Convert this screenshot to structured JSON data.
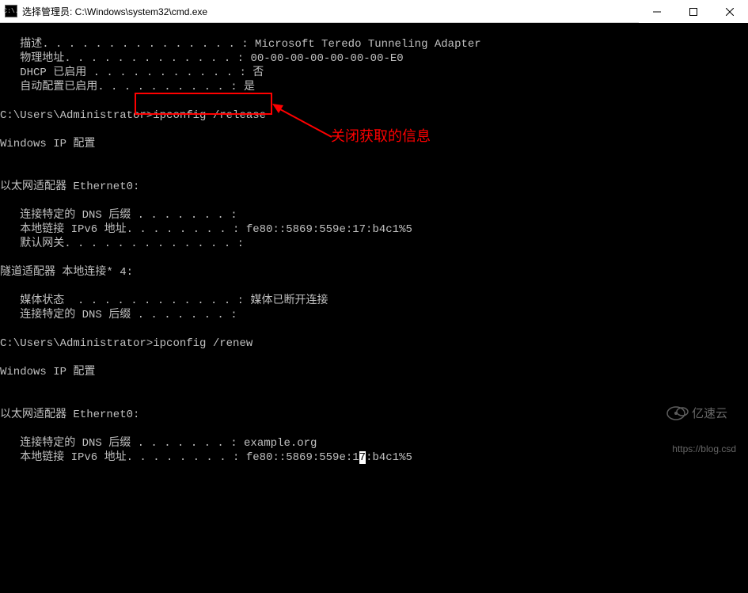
{
  "titlebar": {
    "icon_label": "C:\\.",
    "text": "选择管理员: C:\\Windows\\system32\\cmd.exe"
  },
  "terminal": {
    "lines": {
      "l1": "   描述. . . . . . . . . . . . . . . : Microsoft Teredo Tunneling Adapter",
      "l2": "   物理地址. . . . . . . . . . . . . : 00-00-00-00-00-00-00-E0",
      "l3": "   DHCP 已启用 . . . . . . . . . . . : 否",
      "l4": "   自动配置已启用. . . . . . . . . . : 是",
      "l5": "",
      "l6_pre": "C:\\Users\\Administrator>",
      "l6_cmd": "ipconfig /release",
      "l7": "",
      "l8": "Windows IP 配置",
      "l9": "",
      "l10": "",
      "l11": "以太网适配器 Ethernet0:",
      "l12": "",
      "l13": "   连接特定的 DNS 后缀 . . . . . . . :",
      "l14": "   本地链接 IPv6 地址. . . . . . . . : fe80::5869:559e:17:b4c1%5",
      "l15": "   默认网关. . . . . . . . . . . . . :",
      "l16": "",
      "l17": "隧道适配器 本地连接* 4:",
      "l18": "",
      "l19": "   媒体状态  . . . . . . . . . . . . : 媒体已断开连接",
      "l20": "   连接特定的 DNS 后缀 . . . . . . . :",
      "l21": "",
      "l22_pre": "C:\\Users\\Administrator>",
      "l22_cmd": "ipconfig /renew",
      "l23": "",
      "l24": "Windows IP 配置",
      "l25": "",
      "l26": "",
      "l27": "以太网适配器 Ethernet0:",
      "l28": "",
      "l29": "   连接特定的 DNS 后缀 . . . . . . . : example.org",
      "l30a": "   本地链接 IPv6 地址. . . . . . . . : fe80::5869:559e:1",
      "l30sel": "7",
      "l30b": ":b4c1%5"
    }
  },
  "annotation": {
    "text": "关闭获取的信息"
  },
  "watermark": {
    "brand": "亿速云",
    "url": "https://blog.csd"
  }
}
